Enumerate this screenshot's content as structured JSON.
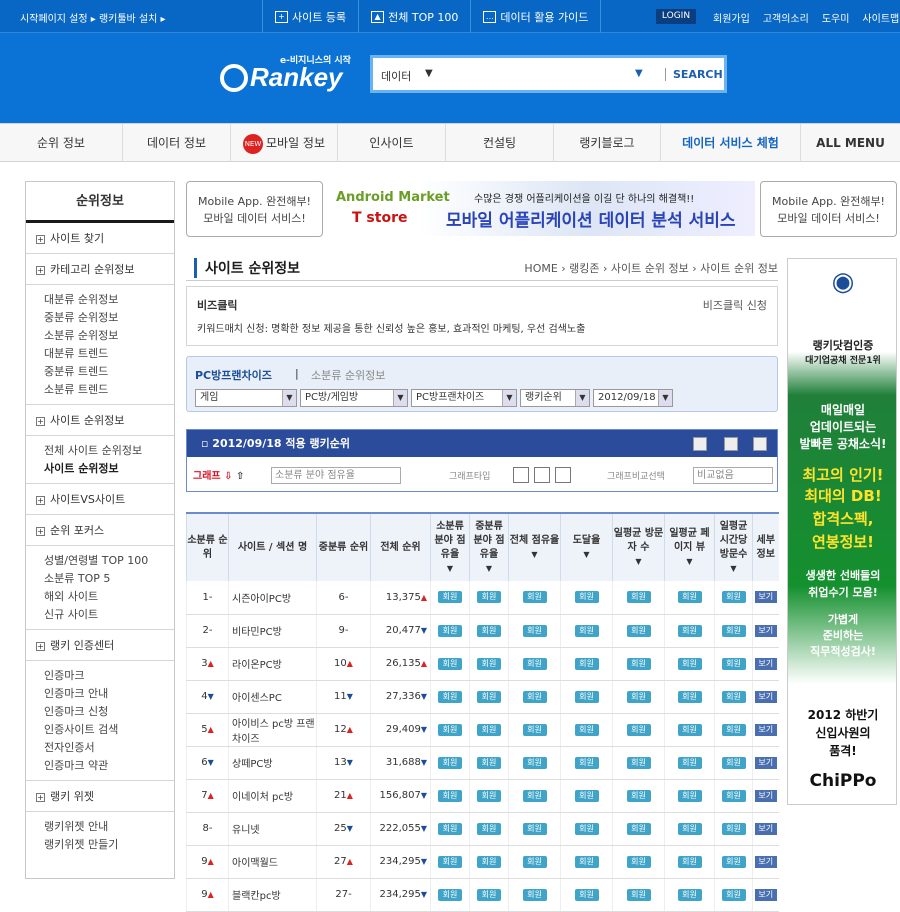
{
  "topbar": {
    "left": "시작페이지 설정 ▸ 랭키툴바 설치 ▸",
    "site_reg": "사이트 등록",
    "top100": "전체 TOP 100",
    "guide": "데이터 활용 가이드",
    "login": "LOGIN",
    "right": [
      "회원가입",
      "고객의소리",
      "도우미",
      "사이트맵"
    ]
  },
  "logo": {
    "tagline": "e-비지니스의 시작",
    "name": "Rankey"
  },
  "search": {
    "category": "데이터",
    "button": "SEARCH"
  },
  "nav": [
    "순위 정보",
    "데이터 정보",
    "모바일 정보",
    "인사이트",
    "컨설팅",
    "랭키블로그",
    "데이터 서비스 체험",
    "ALL MENU"
  ],
  "nav_new": "NEW",
  "sidebar": {
    "title": "순위정보",
    "sections": [
      {
        "label": "사이트 찾기",
        "items": []
      },
      {
        "label": "카테고리 순위정보",
        "items": [
          "대분류 순위정보",
          "중분류 순위정보",
          "소분류 순위정보",
          "대분류 트렌드",
          "중분류 트렌드",
          "소분류 트렌드"
        ]
      },
      {
        "label": "사이트 순위정보",
        "items": [
          "전체 사이트 순위정보",
          "사이트 순위정보"
        ]
      },
      {
        "label": "사이트VS사이트",
        "items": []
      },
      {
        "label": "순위 포커스",
        "items": [
          "성별/연령별 TOP 100",
          "소분류 TOP 5",
          "해외 사이트",
          "신규 사이트"
        ]
      },
      {
        "label": "랭키 인증센터",
        "items": [
          "인증마크",
          "인증마크 안내",
          "인증마크 신청",
          "인증사이트 검색",
          "전자인증서",
          "인증마크 약관"
        ]
      },
      {
        "label": "랭키 위젯",
        "items": [
          "랭키위젯 안내",
          "랭키위젯 만들기"
        ]
      }
    ]
  },
  "banner": {
    "left": [
      "Mobile App. 완전해부!",
      "모바일 데이터 서비스!"
    ],
    "android": "Android Market",
    "tstore": "T store",
    "slogan": "수많은 경쟁 어플리케이션을 이길 단 하나의 해결책!!",
    "main": "모바일 어플리케이션 데이터 분석 서비스",
    "right": [
      "Mobile App. 완전해부!",
      "모바일 데이터 서비스!"
    ]
  },
  "page": {
    "title": "사이트 순위정보",
    "breadcrumb": "HOME › 랭킹존 › 사이트 순위 정보 › 사이트 순위 정보"
  },
  "bizclick": {
    "title": "비즈클릭",
    "apply": "비즈클릭 신청",
    "desc": "키워드매치 신청: 명확한 정보 제공을 통한 신뢰성 높은 홍보, 효과적인 마케팅, 우선 검색노출"
  },
  "filter": {
    "current": "PC방프랜차이즈",
    "sep": "|",
    "link": "소분류 순위정보",
    "selects": [
      "게임",
      "PC방/게임방",
      "PC방프랜차이즈",
      "랭키순위",
      "2012/09/18"
    ]
  },
  "graph": {
    "header": "2012/09/18 적용 랭키순위",
    "graph_label": "그래프",
    "share": "소분류 분야 점유율",
    "type_label": "그래프타입",
    "compare_label": "그래프비교선택",
    "compare": "비교없음"
  },
  "table": {
    "headers": [
      "소분류 순위",
      "사이트 / 섹션 명",
      "중분류 순위",
      "전체 순위",
      "소분류 분야 점유율",
      "중분류 분야 점유율",
      "전체 점유율",
      "도달율",
      "일평균 방문자 수",
      "일평균 페이지 뷰",
      "일평균 시간당 방문수",
      "세부 정보"
    ],
    "member": "회원",
    "view": "보기",
    "rows": [
      {
        "rank": "1",
        "rd": "-",
        "name": "시즌아이PC방",
        "mid": "6",
        "md": "-",
        "total": "13,375",
        "td": "▲"
      },
      {
        "rank": "2",
        "rd": "-",
        "name": "비타민PC방",
        "mid": "9",
        "md": "-",
        "total": "20,477",
        "td": "▼"
      },
      {
        "rank": "3",
        "rd": "▲",
        "name": "라이온PC방",
        "mid": "10",
        "md": "▲",
        "total": "26,135",
        "td": "▲"
      },
      {
        "rank": "4",
        "rd": "▼",
        "name": "아이센스PC",
        "mid": "11",
        "md": "▼",
        "total": "27,336",
        "td": "▼"
      },
      {
        "rank": "5",
        "rd": "▲",
        "name": "아이비스 pc방 프랜차이즈",
        "mid": "12",
        "md": "▲",
        "total": "29,409",
        "td": "▼"
      },
      {
        "rank": "6",
        "rd": "▼",
        "name": "상떼PC방",
        "mid": "13",
        "md": "▼",
        "total": "31,688",
        "td": "▼"
      },
      {
        "rank": "7",
        "rd": "▲",
        "name": "이네이처 pc방",
        "mid": "21",
        "md": "▲",
        "total": "156,807",
        "td": "▼"
      },
      {
        "rank": "8",
        "rd": "-",
        "name": "유니넷",
        "mid": "25",
        "md": "▼",
        "total": "222,055",
        "td": "▼"
      },
      {
        "rank": "9",
        "rd": "▲",
        "name": "아이맥월드",
        "mid": "27",
        "md": "▲",
        "total": "234,295",
        "td": "▼"
      },
      {
        "rank": "9",
        "rd": "▲",
        "name": "블랙칸pc방",
        "mid": "27",
        "md": "-",
        "total": "234,295",
        "td": "▼"
      }
    ]
  },
  "side_banner": {
    "cert1": "랭키닷컴인증",
    "cert2": "대기업공채 전문1위",
    "l1": "매일매일",
    "l2": "업데이트되는",
    "l3": "발빠른 공채소식!",
    "l4": "최고의 인기!",
    "l5": "최대의 DB!",
    "l6": "합격스펙,",
    "l7": "연봉정보!",
    "l8": "생생한 선배들의",
    "l9": "취업수기 모음!",
    "l10": "가볍게",
    "l11": "준비하는",
    "l12": "직무적성검사!",
    "l13": "2012 하반기",
    "l14": "신입사원의",
    "l15": "품격!",
    "brand": "ChiPPo"
  }
}
